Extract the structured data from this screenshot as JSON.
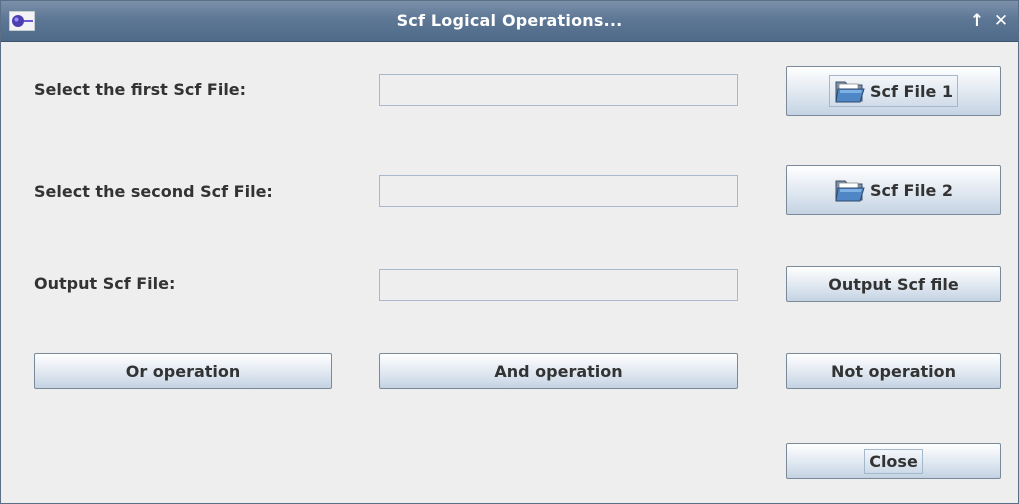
{
  "window": {
    "title": "Scf Logical Operations...",
    "maximize_glyph": "↑",
    "close_glyph": "✕"
  },
  "rows": [
    {
      "label": "Select the first Scf File:",
      "field_value": "",
      "button_label": "Scf File 1",
      "button_icon": "folder-open-icon"
    },
    {
      "label": "Select the second Scf File:",
      "field_value": "",
      "button_label": "Scf File 2",
      "button_icon": "folder-open-icon"
    },
    {
      "label": "Output Scf File:",
      "field_value": "",
      "button_label": "Output Scf file"
    }
  ],
  "operations": {
    "or_label": "Or operation",
    "and_label": "And operation",
    "not_label": "Not operation"
  },
  "footer": {
    "close_label": "Close"
  },
  "colors": {
    "titlebar": "#5d7795",
    "window_bg": "#eeeeee",
    "button_border": "#7a8a99",
    "field_border": "#a8b8cc",
    "text": "#333333"
  }
}
